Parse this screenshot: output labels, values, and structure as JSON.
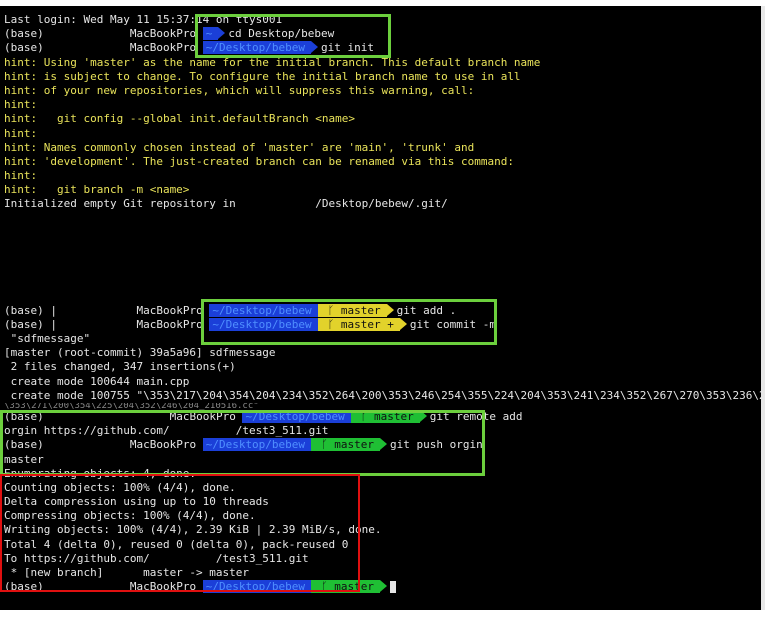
{
  "terminal": {
    "last_login": "Last login: Wed May 11 15:37:14 on ttys001",
    "prompt": {
      "env": "(base)",
      "host": "MacBookPro",
      "tilde": "~",
      "dir": "~/Desktop/bebew",
      "branch": "master",
      "branch_plus": "master +"
    },
    "cmd_cd": "cd Desktop/bebew",
    "cmd_init": "git init",
    "init_hints": [
      "hint: Using 'master' as the name for the initial branch. This default branch name",
      "hint: is subject to change. To configure the initial branch name to use in all",
      "hint: of your new repositories, which will suppress this warning, call:",
      "hint:",
      "hint:   git config --global init.defaultBranch <name>",
      "hint:",
      "hint: Names commonly chosen instead of 'master' are 'main', 'trunk' and",
      "hint: 'development'. The just-created branch can be renamed via this command:",
      "hint:",
      "hint:   git branch -m <name>"
    ],
    "init_result_prefix": "Initialized empty Git repository in ",
    "init_result_suffix": "/Desktop/bebew/.git/",
    "cmd_add": "git add .",
    "cmd_commit": "git commit -m",
    "commit_msg": " \"sdfmessage\"",
    "commit_output": [
      "[master (root-commit) 39a5a96] sdfmessage",
      " 2 files changed, 347 insertions(+)",
      " create mode 100644 main.cpp",
      " create mode 100755 \"\\353\\217\\204\\354\\204\\234\\352\\264\\200\\353\\246\\254\\355\\224\\204\\353\\241\\234\\352\\267\\270\\353\\236\\250_Hustar3",
      "\\353\\271\\200\\354\\225\\204\\352\\246\\204_210516.cc\""
    ],
    "cmd_remote": "git remote add",
    "remote_cont": "orgin https://github.com/          /test3_511.git",
    "cmd_push": "git push orgin",
    "push_cont": "master",
    "push_output": [
      "Enumerating objects: 4, done.",
      "Counting objects: 100% (4/4), done.",
      "Delta compression using up to 10 threads",
      "Compressing objects: 100% (4/4), done.",
      "Writing objects: 100% (4/4), 2.39 KiB | 2.39 MiB/s, done.",
      "Total 4 (delta 0), reused 0 (delta 0), pack-reused 0",
      "To https://github.com/          /test3_511.git",
      " * [new branch]      master -> master"
    ]
  },
  "colors": {
    "background": "#000000",
    "text": "#e6e6e6",
    "hint": "#e9e35a",
    "dir_segment": "#1b3fd8",
    "branch_dirty": "#e2d22b",
    "branch_clean": "#1fbf34",
    "highlight_box": "#6ccf3d",
    "output_box": "#e01010"
  }
}
